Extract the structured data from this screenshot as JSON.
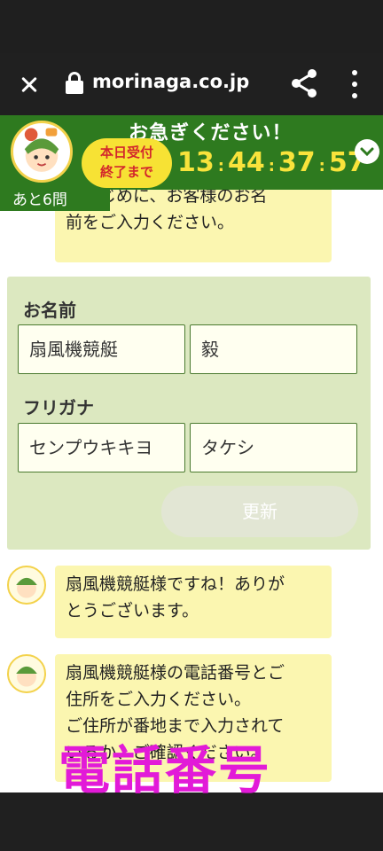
{
  "browser": {
    "url": "morinaga.co.jp"
  },
  "timer": {
    "hurry_text": "お急ぎください！",
    "deadline_line1": "本日受付",
    "deadline_line2": "終了まで",
    "hours": "13",
    "minutes": "44",
    "seconds": "37",
    "frames": "57",
    "remaining": "あと6問"
  },
  "chat": {
    "intro_partial": "ずはじめに、お客様のお名",
    "intro_line2": "前をご入力ください。",
    "reply1_line1": "扇風機競艇様ですね！ありが",
    "reply1_line2": "とうございます。",
    "reply2_line1": "扇風機競艇様の電話番号とご",
    "reply2_line2": "住所をご入力ください。",
    "reply2_line3": "ご住所が番地まで入力されて",
    "reply2_line4": "いるか、ご確認ください。"
  },
  "form": {
    "name_label": "お名前",
    "last_name": "扇風機競艇",
    "first_name": "毅",
    "kana_label": "フリガナ",
    "last_kana": "センプウキキヨ",
    "first_kana": "タケシ",
    "update_label": "更新"
  },
  "overlay": {
    "text": "電話番号"
  },
  "colors": {
    "header_green": "#2e7a1f",
    "timer_yellow": "#f9e33b",
    "bubble_yellow": "#fbf6b0",
    "panel_green": "#dce8c0",
    "overlay_magenta": "#e21ad8"
  }
}
